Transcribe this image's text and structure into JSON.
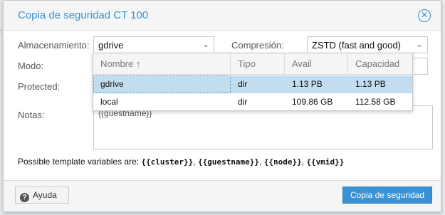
{
  "dialog": {
    "title": "Copia de seguridad CT 100",
    "close_icon": "close-circle-icon"
  },
  "form": {
    "storage_label": "Almacenamiento:",
    "storage_value": "gdrive",
    "compression_label": "Compresión:",
    "compression_value": "ZSTD (fast and good)",
    "mode_label": "Modo:",
    "protected_label": "Protected:",
    "notes_label": "Notas:",
    "notes_value": "{{guestname}}",
    "template_prefix": "Possible template variables are: ",
    "template_vars": [
      "{{cluster}}",
      "{{guestname}}",
      "{{node}}",
      "{{vmid}}"
    ],
    "template_sep": ", "
  },
  "storage_grid": {
    "columns": [
      "Nombre ↑",
      "Tipo",
      "Avail",
      "Capacidad"
    ],
    "rows": [
      {
        "name": "gdrive",
        "type": "dir",
        "avail": "1.13 PB",
        "capacity": "1.13 PB",
        "selected": true
      },
      {
        "name": "local",
        "type": "dir",
        "avail": "109.86 GB",
        "capacity": "112.58 GB",
        "selected": false
      }
    ]
  },
  "footer": {
    "help_label": "Ayuda",
    "help_icon": "question-circle-icon",
    "submit_label": "Copia de seguridad"
  },
  "colors": {
    "accent": "#3892d4",
    "selected_row": "#c3ddf0"
  }
}
